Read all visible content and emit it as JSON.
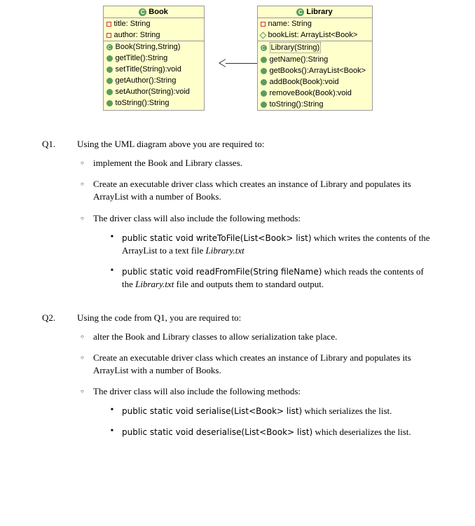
{
  "uml": {
    "book": {
      "title": "Book",
      "attrs": [
        {
          "icon": "red",
          "text": "title: String"
        },
        {
          "icon": "red",
          "text": "author: String"
        }
      ],
      "methods": [
        {
          "icon": "ctor",
          "text": "Book(String,String)"
        },
        {
          "icon": "method",
          "text": "getTitle():String"
        },
        {
          "icon": "method",
          "text": "setTitle(String):void"
        },
        {
          "icon": "method",
          "text": "getAuthor():String"
        },
        {
          "icon": "method",
          "text": "setAuthor(String):void"
        },
        {
          "icon": "method",
          "text": "toString():String"
        }
      ]
    },
    "library": {
      "title": "Library",
      "attrs": [
        {
          "icon": "red",
          "text": "name: String"
        },
        {
          "icon": "green",
          "text": "bookList: ArrayList<Book>"
        }
      ],
      "methods": [
        {
          "icon": "ctor",
          "text": "Library(String)",
          "selected": true
        },
        {
          "icon": "method",
          "text": "getName():String"
        },
        {
          "icon": "method",
          "text": "getBooks():ArrayList<Book>"
        },
        {
          "icon": "method",
          "text": "addBook(Book):void"
        },
        {
          "icon": "method",
          "text": "removeBook(Book):void"
        },
        {
          "icon": "method",
          "text": "toString():String"
        }
      ]
    }
  },
  "q1": {
    "label": "Q1.",
    "lead": "Using the UML diagram above you are required to:",
    "items": [
      "implement the Book and Library classes.",
      "Create an executable driver class which creates an instance of Library and populates its ArrayList with a number of Books.",
      "The driver class will also include the following methods:"
    ],
    "sub": [
      {
        "code": "public static void writeToFile(List<Book> list)",
        "tail": " which writes the contents of the ArrayList to a text file ",
        "ital": "Library.txt"
      },
      {
        "code": "public static void readFromFile(String fileName)",
        "tail": " which reads the contents of the ",
        "ital": "Library.txt",
        "tail2": " file and outputs them to standard output."
      }
    ]
  },
  "q2": {
    "label": "Q2.",
    "lead": "Using the code from Q1, you are required to:",
    "items": [
      "alter the Book and Library classes to allow serialization take place.",
      "Create an executable driver class which creates an instance of Library and populates its ArrayList with a number of Books.",
      "The driver class will also include the following methods:"
    ],
    "sub": [
      {
        "code": "public static void serialise(List<Book> list)",
        "tail": " which serializes the list."
      },
      {
        "code": "public static void deserialise(List<Book> list)",
        "tail": " which deserializes the list."
      }
    ]
  }
}
